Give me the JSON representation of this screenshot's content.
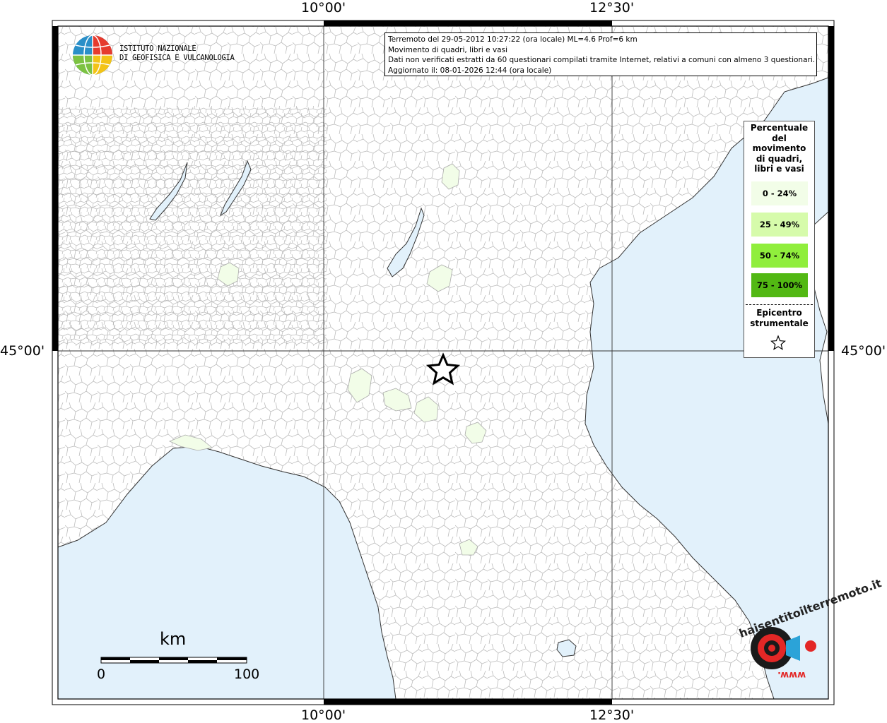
{
  "axes": {
    "top_left_lon": "10°00'",
    "top_right_lon": "12°30'",
    "bottom_left_lon": "10°00'",
    "bottom_right_lon": "12°30'",
    "left_lat": "45°00'",
    "right_lat": "45°00'"
  },
  "logo": {
    "line1": "ISTITUTO NAZIONALE",
    "line2": "DI GEOFISICA E VULCANOLOGIA"
  },
  "info": {
    "line1": "Terremoto del 29-05-2012 10:27:22 (ora locale) ML=4.6 Prof=6 km",
    "line2": "Movimento di quadri, libri e vasi",
    "line3": "Dati non verificati estratti da 60 questionari compilati tramite Internet, relativi a comuni con almeno 3 questionari.",
    "line4": "Aggiornato il: 08-01-2026 12:44 (ora locale)"
  },
  "legend": {
    "title_lines": [
      "Percentuale",
      "del",
      "movimento",
      "di quadri,",
      "libri e vasi"
    ],
    "items": [
      {
        "label": "0 - 24%",
        "color": "#f2fde8"
      },
      {
        "label": "25 - 49%",
        "color": "#d6fbab"
      },
      {
        "label": "50 - 74%",
        "color": "#90ee3c"
      },
      {
        "label": "75 - 100%",
        "color": "#52b813"
      }
    ],
    "epicenter_lines": [
      "Epicentro",
      "strumentale"
    ]
  },
  "scale_bar": {
    "unit": "km",
    "min_label": "0",
    "max_label": "100"
  },
  "colors": {
    "sea": "#e2f1fb",
    "land": "#ffffff",
    "felt_0_24": "#f2fde8",
    "border_lines": "#b5b5b5",
    "frame": "#000000"
  },
  "watermark": {
    "arc_text": "haisentitoilterremoto.it",
    "bottom_text": "www."
  }
}
